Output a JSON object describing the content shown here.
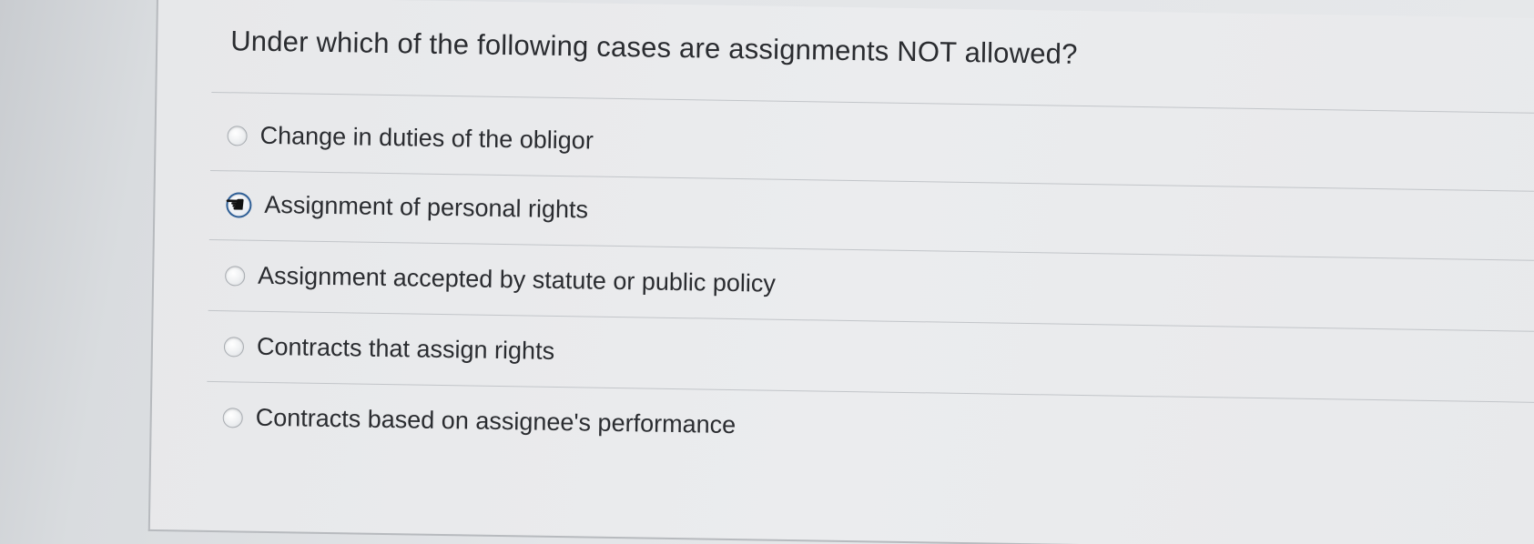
{
  "question": {
    "text": "Under which of the following cases are assignments NOT allowed?"
  },
  "options": [
    {
      "label": "Change in duties of the obligor",
      "selected": false,
      "hovered": false
    },
    {
      "label": "Assignment of personal rights",
      "selected": false,
      "hovered": true
    },
    {
      "label": "Assignment accepted by statute or public policy",
      "selected": false,
      "hovered": false
    },
    {
      "label": "Contracts that assign rights",
      "selected": false,
      "hovered": false
    },
    {
      "label": "Contracts based on assignee's performance",
      "selected": false,
      "hovered": false
    }
  ],
  "cursor": {
    "icon": "hand-pointer-icon"
  },
  "colors": {
    "text": "#2a2c30",
    "divider": "#c2c5c9",
    "radio_border": "#a7abb0",
    "hover_ring": "#2f5f96"
  }
}
